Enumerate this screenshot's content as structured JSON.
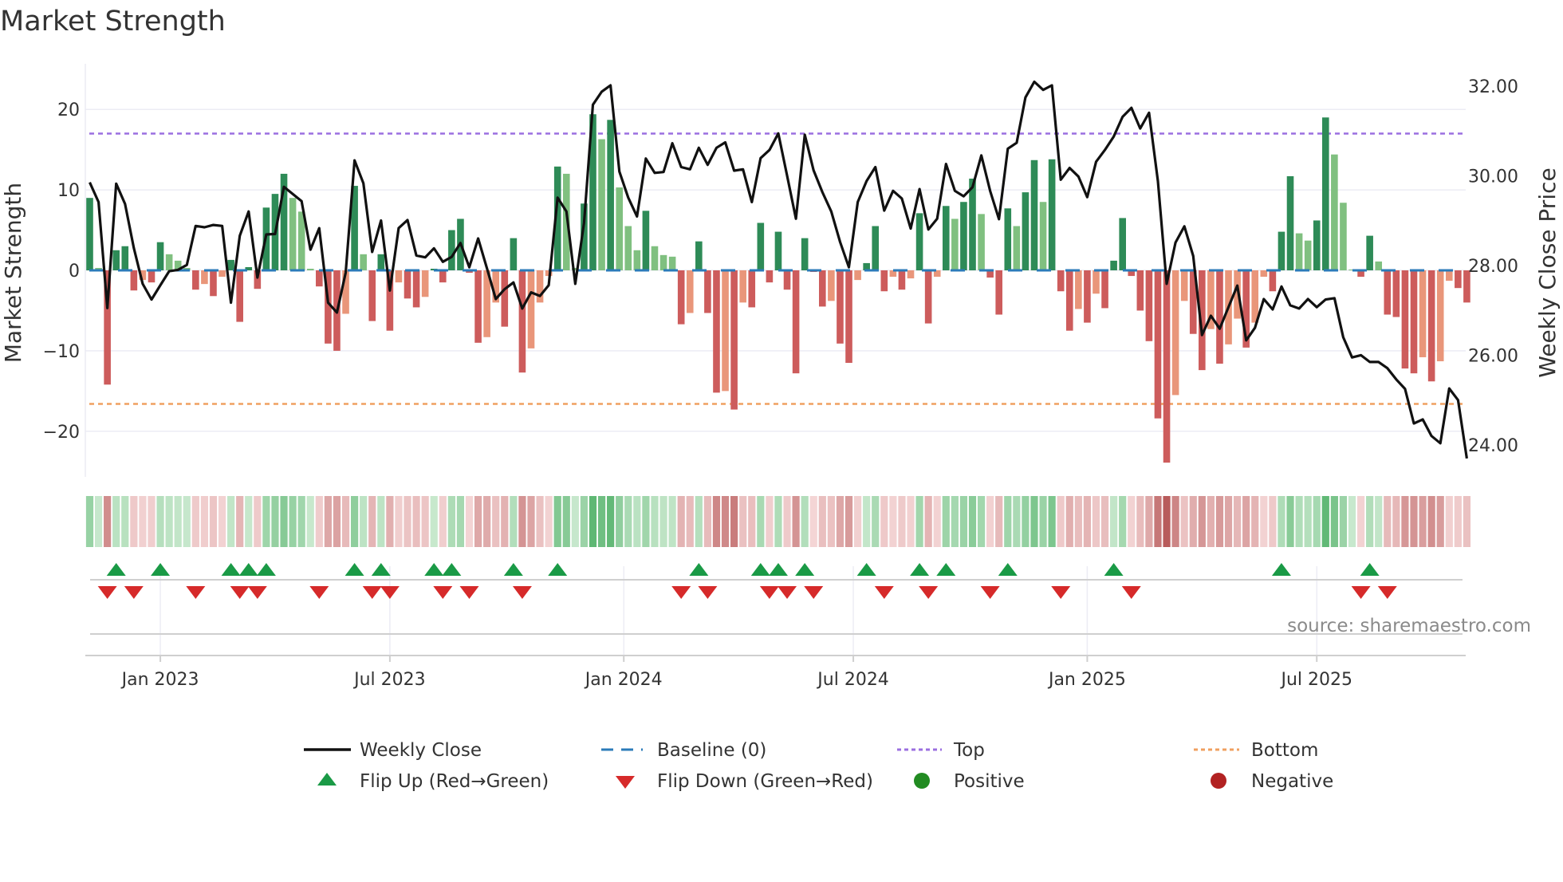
{
  "title": "Market Strength",
  "source": "source: sharemaestro.com",
  "colors": {
    "pos_strong": "#2e8b57",
    "pos_weak": "#80c080",
    "neg_strong": "#cd5c5c",
    "neg_weak": "#e9967a",
    "close": "#111111",
    "baseline": "#2b7bb9",
    "top": "#9b6fe0",
    "bottom": "#f0a060",
    "flip_up": "#1a9a46",
    "flip_down": "#d62a2a",
    "positive": "#228b22",
    "negative": "#b22222"
  },
  "chart_data": {
    "type": "bar",
    "title": "Market Strength",
    "ylabel": "Market Strength",
    "y2label": "Weekly Close Price",
    "ylim": [
      -26,
      26
    ],
    "y2lim": [
      23.3,
      32.6
    ],
    "yticks": [
      "20",
      "10",
      "0",
      "−10",
      "−20"
    ],
    "ytick_values": [
      20,
      10,
      0,
      -10,
      -20
    ],
    "y2ticks": [
      "32.00",
      "30.00",
      "28.00",
      "26.00",
      "24.00"
    ],
    "y2tick_values": [
      32,
      30,
      28,
      26,
      24
    ],
    "xticks": [
      "Jan 2023",
      "Jul 2023",
      "Jan 2024",
      "Jul 2024",
      "Jan 2025",
      "Jul 2025"
    ],
    "xtick_week_index": [
      8,
      34,
      60.5,
      86.5,
      113,
      139
    ],
    "top_level": 17,
    "bottom_level": -16.6,
    "baseline": 0,
    "grid": true,
    "legend_placement": "bottom",
    "legend": [
      {
        "label": "Weekly Close",
        "kind": "line"
      },
      {
        "label": "Baseline (0)",
        "kind": "dash"
      },
      {
        "label": "Top",
        "kind": "dot-top"
      },
      {
        "label": "Bottom",
        "kind": "dot-bottom"
      },
      {
        "label": "Flip Up (Red→Green)",
        "kind": "tri-up"
      },
      {
        "label": "Flip Down (Green→Red)",
        "kind": "tri-down"
      },
      {
        "label": "Positive",
        "kind": "circle-pos"
      },
      {
        "label": "Negative",
        "kind": "circle-neg"
      }
    ],
    "strength": [
      9,
      0.3,
      -14.2,
      2.5,
      3,
      -2.5,
      -1.2,
      -1.5,
      3.5,
      2,
      1.2,
      0.3,
      -2.4,
      -1.7,
      -3.2,
      -0.8,
      1.3,
      -6.4,
      0.4,
      -2.3,
      7.8,
      9.5,
      12,
      9,
      7.3,
      0.2,
      -2,
      -9.1,
      -10,
      -5.4,
      10.5,
      2,
      -6.3,
      2,
      -7.5,
      -1.5,
      -3.5,
      -4.6,
      -3.3,
      0.2,
      -1.5,
      5,
      6.4,
      -0.3,
      -9,
      -8.3,
      -4,
      -7,
      4,
      -12.7,
      -9.7,
      -4,
      -0.7,
      12.9,
      12,
      0.3,
      8.3,
      19.4,
      16.3,
      18.7,
      10.3,
      5.5,
      2.5,
      7.4,
      3,
      1.9,
      1.7,
      -6.7,
      -5.3,
      3.6,
      -5.3,
      -15.2,
      -15,
      -17.3,
      -4,
      -4.6,
      5.9,
      -1.5,
      4.8,
      -2.4,
      -12.8,
      4,
      -0.2,
      -4.5,
      -3.8,
      -9.1,
      -11.5,
      -1.2,
      0.9,
      5.5,
      -2.6,
      -0.8,
      -2.4,
      -1,
      7.1,
      -6.6,
      -0.8,
      8,
      6.4,
      8.5,
      11.4,
      7,
      -0.9,
      -5.5,
      7.7,
      5.5,
      9.7,
      13.7,
      8.5,
      13.8,
      -2.6,
      -7.5,
      -4.8,
      -6.5,
      -2.9,
      -4.7,
      1.2,
      6.5,
      -0.7,
      -5,
      -8.8,
      -18.4,
      -23.9,
      -15.5,
      -3.8,
      -7.9,
      -12.4,
      -7.3,
      -11.6,
      -9.2,
      -6,
      -9.6,
      -6.5,
      -0.8,
      -2.6,
      4.8,
      11.7,
      4.6,
      3.7,
      6.2,
      19,
      14.4,
      8.4,
      0.1,
      -0.8,
      4.3,
      1.1,
      -5.5,
      -5.8,
      -12.2,
      -12.8,
      -10.8,
      -13.8,
      -11.3,
      -1.3,
      -2.2,
      -4
    ],
    "close": [
      29.96,
      29.52,
      27.16,
      29.93,
      29.48,
      28.5,
      27.7,
      27.35,
      27.67,
      27.98,
      28.01,
      28.12,
      28.99,
      28.96,
      29.01,
      28.99,
      27.28,
      28.77,
      29.31,
      27.84,
      28.8,
      28.81,
      29.86,
      29.7,
      29.54,
      28.46,
      28.94,
      27.28,
      27.06,
      27.95,
      30.45,
      29.94,
      28.41,
      29.11,
      27.55,
      28.94,
      29.12,
      28.33,
      28.29,
      28.49,
      28.19,
      28.3,
      28.61,
      28.07,
      28.71,
      28.04,
      27.36,
      27.58,
      27.73,
      27.15,
      27.51,
      27.43,
      27.67,
      29.62,
      29.31,
      27.7,
      29.06,
      31.69,
      31.98,
      32.12,
      30.2,
      29.62,
      29.2,
      30.49,
      30.17,
      30.19,
      30.83,
      30.3,
      30.25,
      30.73,
      30.35,
      30.73,
      30.85,
      30.22,
      30.25,
      29.52,
      30.5,
      30.68,
      31.05,
      30.11,
      29.15,
      31.02,
      30.23,
      29.74,
      29.31,
      28.63,
      28.07,
      29.52,
      29.99,
      30.3,
      29.33,
      29.77,
      29.6,
      28.93,
      29.81,
      28.91,
      29.15,
      30.37,
      29.77,
      29.65,
      29.85,
      30.56,
      29.77,
      29.14,
      30.71,
      30.84,
      31.85,
      32.2,
      32.02,
      32.12,
      30.02,
      30.28,
      30.09,
      29.63,
      30.42,
      30.68,
      30.98,
      31.42,
      31.62,
      31.16,
      31.51,
      29.99,
      27.7,
      28.62,
      28.98,
      28.32,
      26.56,
      26.99,
      26.7,
      27.18,
      27.66,
      26.44,
      26.72,
      27.36,
      27.13,
      27.64,
      27.22,
      27.15,
      27.36,
      27.18,
      27.35,
      27.38,
      26.51,
      26.06,
      26.11,
      25.96,
      25.96,
      25.82,
      25.57,
      25.36,
      24.59,
      24.68,
      24.31,
      24.15,
      25.37,
      25.11,
      23.81
    ],
    "flip_up_weeks": [
      3,
      8,
      16,
      18,
      20,
      30,
      33,
      39,
      41,
      48,
      53,
      69,
      76,
      78,
      81,
      88,
      94,
      97,
      104,
      116,
      135,
      145
    ],
    "flip_down_weeks": [
      2,
      5,
      12,
      17,
      19,
      26,
      32,
      34,
      40,
      43,
      49,
      67,
      70,
      77,
      79,
      82,
      90,
      95,
      102,
      110,
      118,
      144,
      147
    ]
  }
}
